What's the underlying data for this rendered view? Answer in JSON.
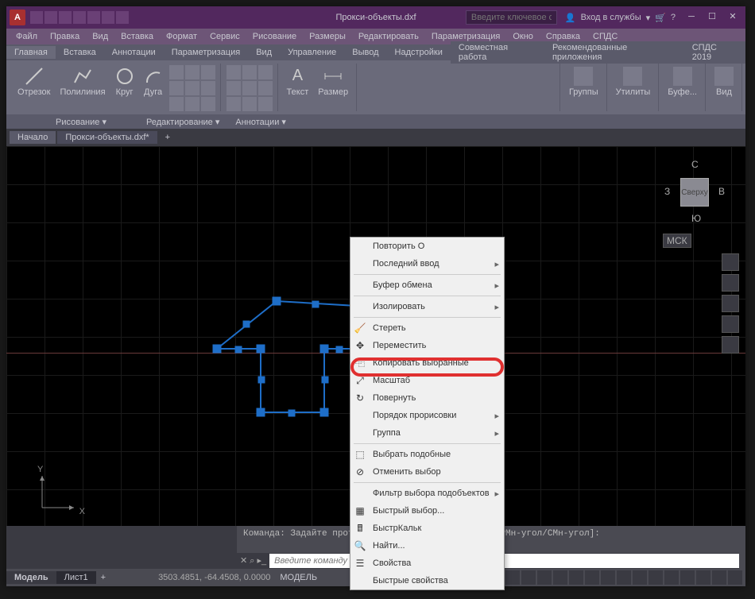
{
  "title": "Прокси-объекты.dxf",
  "search_placeholder": "Введите ключевое слово/фразу",
  "login": "Вход в службы",
  "menubar": [
    "Файл",
    "Правка",
    "Вид",
    "Вставка",
    "Формат",
    "Сервис",
    "Рисование",
    "Размеры",
    "Редактировать",
    "Параметризация",
    "Окно",
    "Справка",
    "СПДС"
  ],
  "tabs": [
    "Главная",
    "Вставка",
    "Аннотации",
    "Параметризация",
    "Вид",
    "Управление",
    "Вывод",
    "Надстройки",
    "Совместная работа",
    "Рекомендованные приложения",
    "СПДС 2019"
  ],
  "ribbon_tools": {
    "otrezok": "Отрезок",
    "polyline": "Полилиния",
    "circle": "Круг",
    "arc": "Дуга",
    "text": "Текст",
    "size": "Размер",
    "groups": "Группы",
    "utils": "Утилиты",
    "bufer": "Буфе...",
    "view": "Вид"
  },
  "ribbon_footer": [
    "Рисование ▾",
    "Редактирование ▾",
    "Аннотации ▾"
  ],
  "doc_tabs": {
    "start": "Начало",
    "active": "Прокси-объекты.dxf*"
  },
  "viewcube": {
    "top": "Сверху",
    "n": "С",
    "s": "Ю",
    "e": "В",
    "w": "З",
    "ucs": "МСК"
  },
  "context_menu": [
    {
      "label": "Повторить О",
      "sub": false
    },
    {
      "label": "Последний ввод",
      "sub": true
    },
    {
      "sep": true
    },
    {
      "label": "Буфер обмена",
      "sub": true
    },
    {
      "sep": true
    },
    {
      "label": "Изолировать",
      "sub": true
    },
    {
      "sep": true
    },
    {
      "label": "Стереть",
      "icon": "🧹"
    },
    {
      "label": "Переместить",
      "icon": "✥"
    },
    {
      "label": "Копировать выбранные",
      "icon": "⿻"
    },
    {
      "label": "Масштаб",
      "icon": "⤢"
    },
    {
      "label": "Повернуть",
      "icon": "↻",
      "hl": true
    },
    {
      "label": "Порядок прорисовки",
      "sub": true
    },
    {
      "label": "Группа",
      "sub": true
    },
    {
      "sep": true
    },
    {
      "label": "Выбрать подобные",
      "icon": "⬚"
    },
    {
      "label": "Отменить выбор",
      "icon": "⊘"
    },
    {
      "sep": true
    },
    {
      "label": "Фильтр выбора подобъектов",
      "sub": true
    },
    {
      "label": "Быстрый выбор...",
      "icon": "▦"
    },
    {
      "label": "БыстрКальк",
      "icon": "🖩"
    },
    {
      "label": "Найти...",
      "icon": "🔍"
    },
    {
      "label": "Свойства",
      "icon": "☰"
    },
    {
      "label": "Быстрые свойства"
    }
  ],
  "cmd_history": "Команда: Задайте противоположный угол или [Линия/РМн-угол/СМн-угол]:",
  "cmd_placeholder": "Введите команду",
  "model_tabs": [
    "Модель",
    "Лист1"
  ],
  "coords": "3503.4851, -64.4508, 0.0000",
  "model_label": "МОДЕЛЬ",
  "ucs_labels": {
    "x": "X",
    "y": "Y"
  }
}
